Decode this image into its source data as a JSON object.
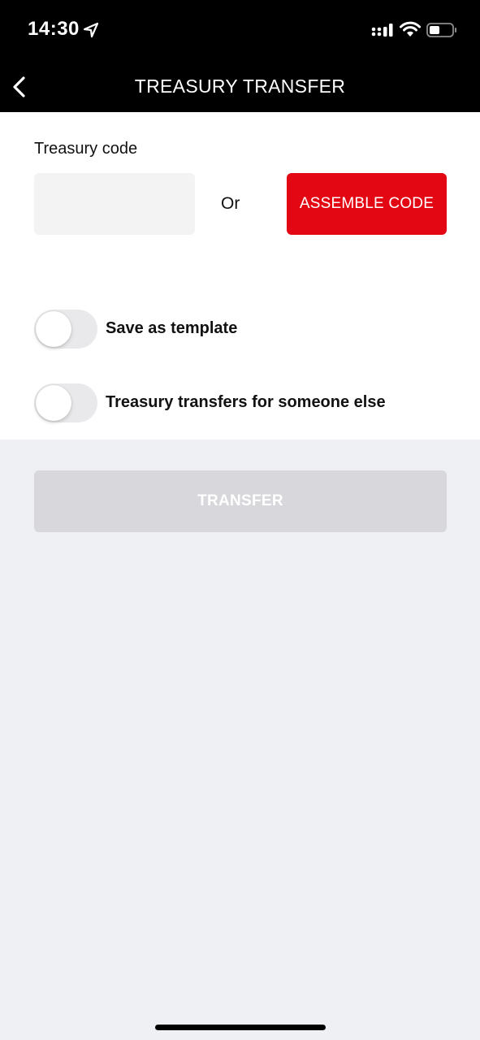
{
  "status_bar": {
    "time": "14:30",
    "icons": [
      "location-arrow-icon",
      "cellular-signal-icon",
      "wifi-icon",
      "battery-icon"
    ]
  },
  "nav": {
    "back_icon": "chevron-left-icon",
    "title": "TREASURY TRANSFER"
  },
  "form": {
    "treasury_code_label": "Treasury code",
    "treasury_code_value": "",
    "or_text": "Or",
    "assemble_button_label": "ASSEMBLE CODE",
    "toggles": [
      {
        "label": "Save as template",
        "on": false
      },
      {
        "label": "Treasury transfers for someone else",
        "on": false
      }
    ]
  },
  "actions": {
    "transfer_label": "TRANSFER",
    "transfer_enabled": false
  },
  "colors": {
    "accent": "#e30613",
    "header_bg": "#000000",
    "page_bg": "#eef0f4",
    "disabled_button": "#d7d7dc"
  }
}
